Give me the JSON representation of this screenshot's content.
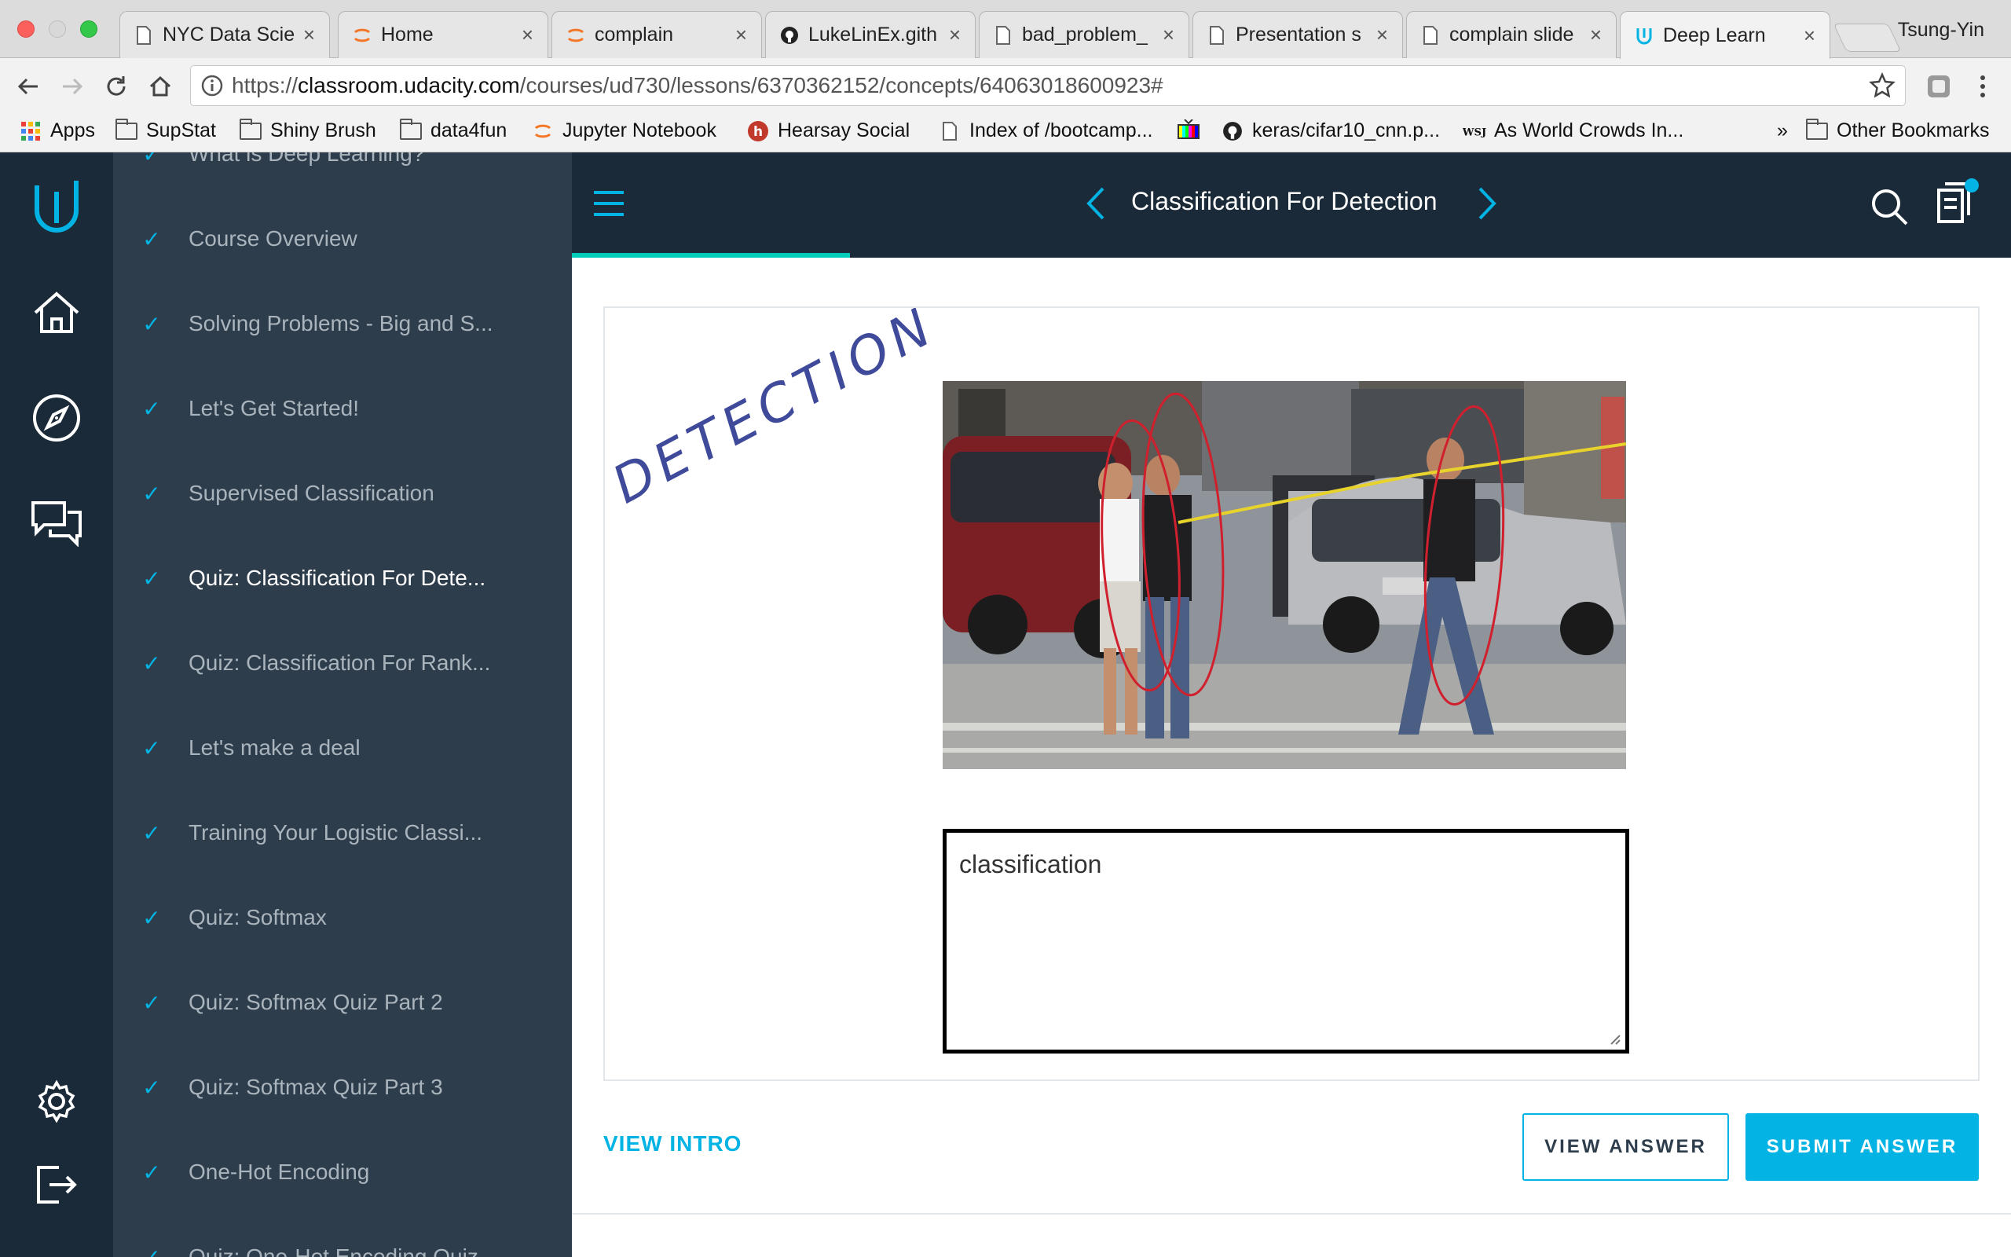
{
  "browser": {
    "tabs": [
      {
        "title": "NYC Data Scie",
        "icon": "file-icon"
      },
      {
        "title": "Home",
        "icon": "jupyter-icon"
      },
      {
        "title": "complain",
        "icon": "jupyter-icon"
      },
      {
        "title": "LukeLinEx.gith",
        "icon": "github-icon"
      },
      {
        "title": "bad_problem_",
        "icon": "file-icon"
      },
      {
        "title": "Presentation s",
        "icon": "file-icon"
      },
      {
        "title": "complain slide",
        "icon": "file-icon"
      },
      {
        "title": "Deep Learn",
        "icon": "udacity-icon",
        "active": true
      }
    ],
    "close_glyph": "×",
    "profile": "Tsung-Yin",
    "url": {
      "scheme": "https://",
      "host": "classroom.udacity.com",
      "path": "/courses/ud730/lessons/6370362152/concepts/64063018600923#"
    },
    "bookmarks": [
      {
        "label": "Apps",
        "icon": "apps-grid-icon"
      },
      {
        "label": "SupStat",
        "icon": "folder-icon"
      },
      {
        "label": "Shiny Brush",
        "icon": "folder-icon"
      },
      {
        "label": "data4fun",
        "icon": "folder-icon"
      },
      {
        "label": "Jupyter Notebook",
        "icon": "jupyter-icon"
      },
      {
        "label": "Hearsay Social",
        "icon": "hearsay-icon"
      },
      {
        "label": "Index of /bootcamp...",
        "icon": "file-icon"
      },
      {
        "label": "",
        "icon": "tv-test-icon"
      },
      {
        "label": "keras/cifar10_cnn.p...",
        "icon": "github-icon"
      },
      {
        "label": "As World Crowds In...",
        "icon": "wsj-icon"
      }
    ],
    "overflow": "»",
    "other_bookmarks": "Other Bookmarks"
  },
  "sidebar": {
    "items": [
      {
        "label": "What is Deep Learning?"
      },
      {
        "label": "Course Overview"
      },
      {
        "label": "Solving Problems - Big and S..."
      },
      {
        "label": "Let's Get Started!"
      },
      {
        "label": "Supervised Classification"
      },
      {
        "label": "Quiz: Classification For Dete...",
        "current": true
      },
      {
        "label": "Quiz: Classification For Rank..."
      },
      {
        "label": "Let's make a deal"
      },
      {
        "label": "Training Your Logistic Classi..."
      },
      {
        "label": "Quiz: Softmax"
      },
      {
        "label": "Quiz: Softmax Quiz Part 2"
      },
      {
        "label": "Quiz: Softmax Quiz Part 3"
      },
      {
        "label": "One-Hot Encoding"
      },
      {
        "label": "Quiz: One-Hot Encoding Quiz"
      }
    ],
    "check_glyph": "✓"
  },
  "header": {
    "title": "Classification For Detection"
  },
  "quiz": {
    "handwriting": "DETECTION",
    "answer_value": "classification"
  },
  "actions": {
    "view_intro": "VIEW INTRO",
    "view_answer": "VIEW ANSWER",
    "submit_answer": "SUBMIT ANSWER"
  },
  "colors": {
    "accent": "#02b3e4",
    "progress": "#02ccba",
    "nav_dark": "#1b2a38",
    "sidebar": "#2e3d4c"
  }
}
